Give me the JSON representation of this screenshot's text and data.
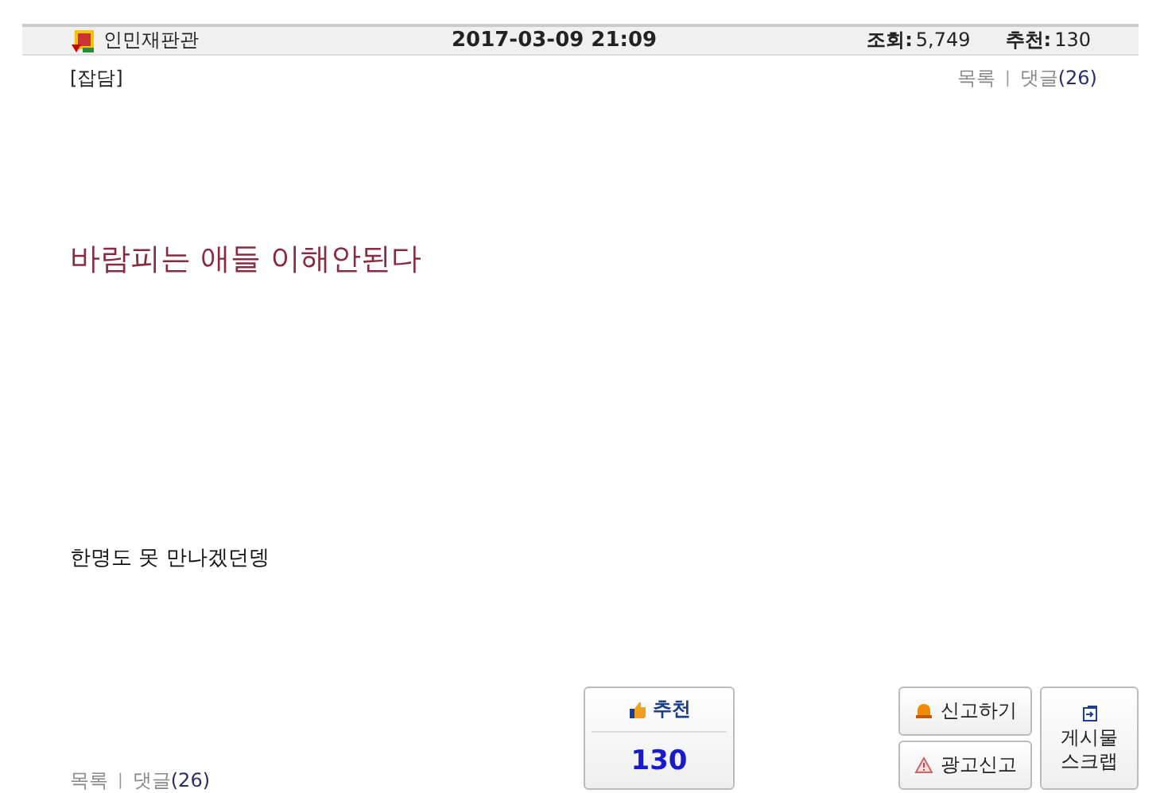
{
  "header": {
    "author": "인민재판관",
    "datetime": "2017-03-09 21:09",
    "views_label": "조회:",
    "views": "5,749",
    "recommend_label": "추천:",
    "recommend": "130"
  },
  "category": "[잡담]",
  "nav_top": {
    "list": "목록",
    "separator": "|",
    "comments": "댓글",
    "count": "(26)"
  },
  "title": "바람피는 애들 이해안된다",
  "body": "한명도 못 만나겠던뎅",
  "nav_bottom": {
    "list": "목록",
    "separator": "|",
    "comments": "댓글",
    "count": "(26)"
  },
  "recommend_button": {
    "label": "추천",
    "count": "130"
  },
  "report_button": "신고하기",
  "ad_report_button": "광고신고",
  "scrap_button": {
    "line1": "게시물",
    "line2": "스크랩"
  }
}
